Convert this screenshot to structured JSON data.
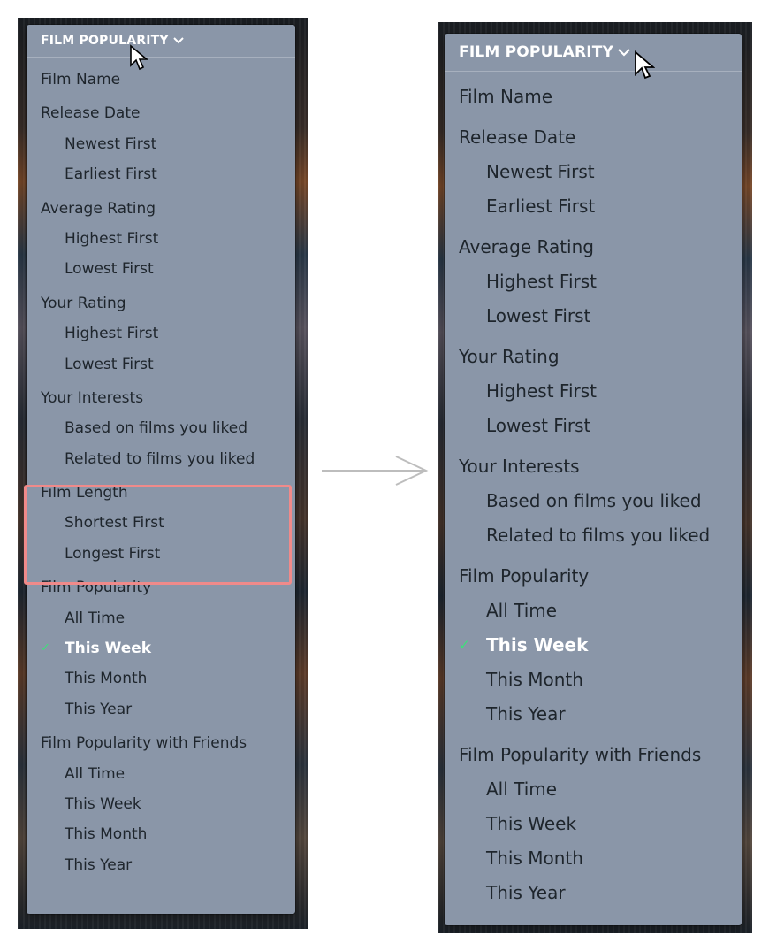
{
  "header_label": "FILM POPULARITY",
  "check_glyph": "✓",
  "colors": {
    "menu_bg": "#8a96a8",
    "selected_text": "#ffffff",
    "check": "#3ee07a",
    "highlight_border": "#f08a8a"
  },
  "icons": [
    "chevron-down-icon",
    "mouse-pointer-icon",
    "check-icon",
    "arrow-right-icon"
  ],
  "menu_items": [
    {
      "label": "Film Name",
      "level": 0
    },
    {
      "label": "Release Date",
      "level": 0
    },
    {
      "label": "Newest First",
      "level": 1
    },
    {
      "label": "Earliest First",
      "level": 1
    },
    {
      "label": "Average Rating",
      "level": 0
    },
    {
      "label": "Highest First",
      "level": 1
    },
    {
      "label": "Lowest First",
      "level": 1
    },
    {
      "label": "Your Rating",
      "level": 0
    },
    {
      "label": "Highest First",
      "level": 1
    },
    {
      "label": "Lowest First",
      "level": 1
    },
    {
      "label": "Your Interests",
      "level": 0
    },
    {
      "label": "Based on films you liked",
      "level": 1
    },
    {
      "label": "Related to films you liked",
      "level": 1
    },
    {
      "label": "Film Length",
      "level": 0
    },
    {
      "label": "Shortest First",
      "level": 1
    },
    {
      "label": "Longest First",
      "level": 1
    },
    {
      "label": "Film Popularity",
      "level": 0
    },
    {
      "label": "All Time",
      "level": 1
    },
    {
      "label": "This Week",
      "level": 1,
      "selected": true
    },
    {
      "label": "This Month",
      "level": 1
    },
    {
      "label": "This Year",
      "level": 1
    },
    {
      "label": "Film Popularity with Friends",
      "level": 0
    },
    {
      "label": "All Time",
      "level": 1
    },
    {
      "label": "This Week",
      "level": 1
    },
    {
      "label": "This Month",
      "level": 1
    },
    {
      "label": "This Year",
      "level": 1
    }
  ]
}
